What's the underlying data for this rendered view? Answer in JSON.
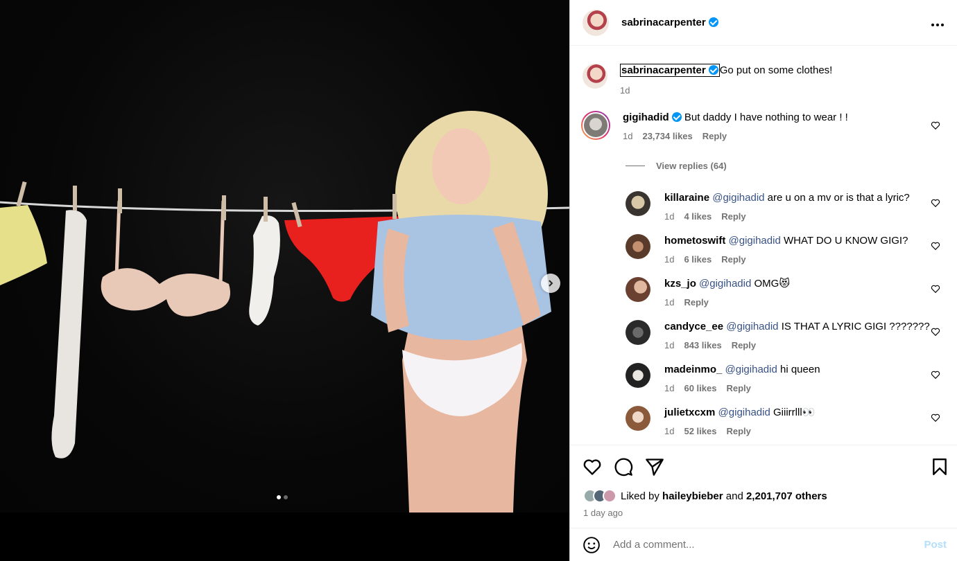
{
  "header": {
    "username": "sabrinacarpenter",
    "more_icon": "ellipsis-icon"
  },
  "caption": {
    "username": "sabrinacarpenter",
    "text": "Go put on some clothes!",
    "time": "1d"
  },
  "comments": [
    {
      "username": "gigihadid",
      "text": "But daddy I have nothing to wear ! !",
      "time": "1d",
      "likes": "23,734 likes",
      "reply": "Reply",
      "view_replies": "View replies (64)"
    }
  ],
  "replies": [
    {
      "username": "killaraine",
      "mention": "@gigihadid",
      "text": "are u on a mv or is that a lyric?",
      "time": "1d",
      "likes": "4 likes",
      "reply": "Reply"
    },
    {
      "username": "hometoswift",
      "mention": "@gigihadid",
      "text": "WHAT DO U KNOW GIGI?",
      "time": "1d",
      "likes": "6 likes",
      "reply": "Reply"
    },
    {
      "username": "kzs_jo",
      "mention": "@gigihadid",
      "text": "OMG😻",
      "time": "1d",
      "likes": "",
      "reply": "Reply"
    },
    {
      "username": "candyce_ee",
      "mention": "@gigihadid",
      "text": "IS THAT A LYRIC GIGI ???????",
      "time": "1d",
      "likes": "843 likes",
      "reply": "Reply"
    },
    {
      "username": "madeinmo_",
      "mention": "@gigihadid",
      "text": "hi queen",
      "time": "1d",
      "likes": "60 likes",
      "reply": "Reply"
    },
    {
      "username": "julietxcxm",
      "mention": "@gigihadid",
      "text": "Giiirrlll👀",
      "time": "1d",
      "likes": "52 likes",
      "reply": "Reply"
    }
  ],
  "actions": {
    "liked_prefix": "Liked by",
    "liked_user": "hailey​bieber",
    "liked_and": "and",
    "liked_count": "2,201,707 others",
    "time_ago": "1 day ago"
  },
  "add_comment": {
    "placeholder": "Add a comment...",
    "post_label": "Post"
  },
  "carousel": {
    "total_slides": 2,
    "active_slide": 1
  },
  "colors": {
    "verified": "#0095f6",
    "mention": "#385185",
    "muted": "#737373",
    "post_disabled": "#b2dffc"
  }
}
